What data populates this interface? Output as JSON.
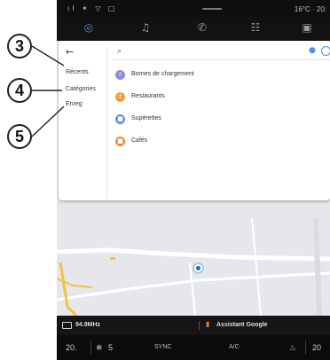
{
  "status_bar": {
    "left_icons": "ıl ✶ ▽ □",
    "right_text": "16°C · 20:"
  },
  "nav_bar": {
    "tabs": [
      {
        "icon": "map-pin-icon",
        "glyph": "◎"
      },
      {
        "icon": "music-icon",
        "glyph": "♫"
      },
      {
        "icon": "phone-icon",
        "glyph": "✆"
      },
      {
        "icon": "apps-grid-icon",
        "glyph": "☷"
      },
      {
        "icon": "car-icon",
        "glyph": "▣"
      }
    ]
  },
  "search_panel": {
    "back_glyph": "←",
    "sidebar": [
      {
        "label": "Récents"
      },
      {
        "label": "Catégories"
      },
      {
        "label": "Enreg"
      }
    ],
    "search_glyph": "⌕",
    "mic_glyph": "●",
    "categories": [
      {
        "label": "Bornes de chargement",
        "color": "#8e8fd8",
        "glyph": "⚡"
      },
      {
        "label": "Restaurants",
        "color": "#f0a040",
        "glyph": "†"
      },
      {
        "label": "Supérettes",
        "color": "#5f8fe6",
        "glyph": "■"
      },
      {
        "label": "Cafés",
        "color": "#f08a3a",
        "glyph": "■"
      }
    ]
  },
  "media_bar": {
    "radio_text": "94.9MHz",
    "voice_glyph": "▮",
    "voice_text": "Assistant Google"
  },
  "climate_bar": {
    "temp_left": "20.",
    "fan_glyph": "❄",
    "fan_level": "5",
    "sync": "SYNC",
    "ac": "A/C",
    "seat_glyph": "♨",
    "temp_right": "20"
  },
  "callouts": [
    "3",
    "4",
    "5"
  ]
}
